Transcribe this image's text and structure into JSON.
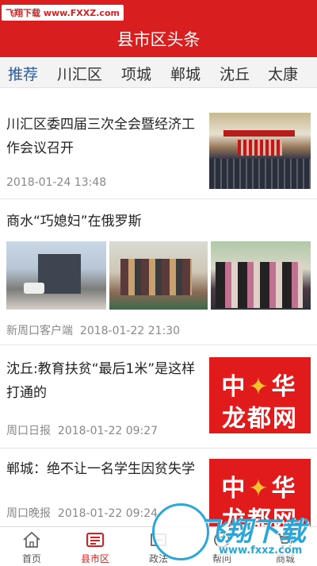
{
  "watermark_top": "飞翔下载 www.FXXZ.com",
  "header": {
    "title": "县市区头条"
  },
  "tabs": [
    "推荐",
    "川汇区",
    "项城",
    "郸城",
    "沈丘",
    "太康"
  ],
  "articles": [
    {
      "title": "川汇区委四届三次全会暨经济工作会议召开",
      "source": "",
      "time": "2018-01-24 13:48"
    },
    {
      "title": "商水“巧媳妇”在俄罗斯",
      "source": "新周口客户端",
      "time": "2018-01-22 21:30"
    },
    {
      "title": "沈丘:教育扶贫“最后1米”是这样打通的",
      "source": "周口日报",
      "time": "2018-01-22 09:27"
    },
    {
      "title": "郸城：绝不让一名学生因贫失学",
      "source": "周口晚报",
      "time": "2018-01-22 09:24"
    }
  ],
  "logo": {
    "line1_a": "中",
    "line1_b": "华",
    "line2": "龙都网"
  },
  "bottom_nav": [
    {
      "label": "首页",
      "icon": "home-icon"
    },
    {
      "label": "县市区",
      "icon": "newspaper-icon"
    },
    {
      "label": "政法",
      "icon": "gavel-icon"
    },
    {
      "label": "帮问",
      "icon": "question-icon"
    },
    {
      "label": "商城",
      "icon": "cart-icon"
    }
  ],
  "watermark_bottom": {
    "brand": "飞翔下载",
    "url": "www.fxxz.com"
  },
  "colors": {
    "brand_red": "#d81e1e",
    "active_tab": "#2a5a9e",
    "watermark_blue": "#2aa7d8"
  }
}
